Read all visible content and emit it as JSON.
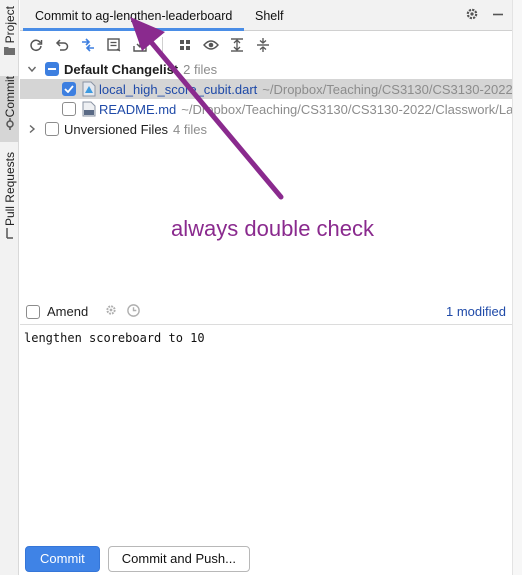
{
  "stripe": {
    "project_label": "Project",
    "commit_label": "Commit",
    "pull_requests_label": "Pull Requests"
  },
  "header": {
    "tab_commit": "Commit to ag-lengthen-leaderboard",
    "tab_shelf": "Shelf"
  },
  "tree": {
    "changelist": {
      "name": "Default Changelist",
      "count": "2 files"
    },
    "files": [
      {
        "name": "local_high_score_cubit.dart",
        "path": "~/Dropbox/Teaching/CS3130/CS3130-2022",
        "checked": true
      },
      {
        "name": "README.md",
        "path": "~/Dropbox/Teaching/CS3130/CS3130-2022/Classwork/La",
        "checked": false
      }
    ],
    "unversioned": {
      "name": "Unversioned Files",
      "count": "4 files"
    }
  },
  "commit": {
    "amend_label": "Amend",
    "modified_label": "1 modified",
    "message": "lengthen scoreboard to 10",
    "commit_button": "Commit",
    "commit_push_button": "Commit and Push..."
  },
  "annotation": {
    "text": "always double check",
    "color": "#8a2a8e"
  },
  "colors": {
    "accent": "#3f83e6",
    "link": "#1f4aa8"
  }
}
